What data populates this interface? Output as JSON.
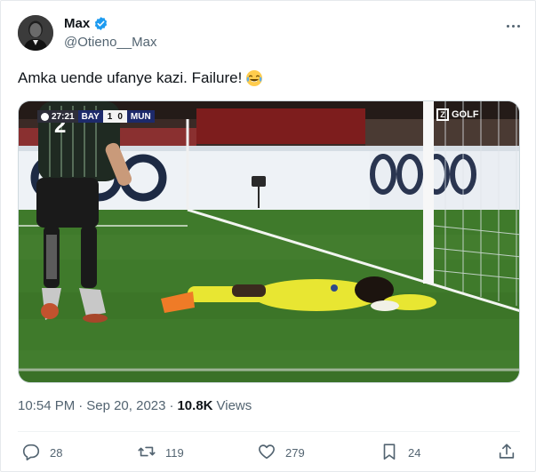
{
  "author": {
    "name": "Max",
    "handle": "@Otieno__Max",
    "verified": true
  },
  "tweet": {
    "text": "Amka uende ufanye kazi. Failure!",
    "emoji": "face-with-tears-of-joy"
  },
  "media": {
    "scorebug": {
      "clock": "27:21",
      "home_team": "BAY",
      "home_score": "1",
      "away_score": "0",
      "away_team": "MUN"
    },
    "broadcaster": "GOLF",
    "broadcaster_logo_letter": "Z",
    "colors": {
      "pitch": "#3f7a2b",
      "keeper_kit": "#e8e632",
      "player_kit": "#1f2a22"
    }
  },
  "meta": {
    "time": "10:54 PM",
    "separator": "·",
    "date": "Sep 20, 2023",
    "views_count": "10.8K",
    "views_label": "Views"
  },
  "actions": {
    "replies": "28",
    "reposts": "119",
    "likes": "279",
    "bookmarks": "24"
  },
  "icons": {
    "verified": "verified-badge-icon",
    "more": "more-options-icon",
    "reply": "reply-icon",
    "repost": "repost-icon",
    "like": "like-icon",
    "bookmark": "bookmark-icon",
    "share": "share-icon"
  },
  "colors": {
    "accent": "#1d9bf0",
    "secondary_text": "#536471",
    "primary_text": "#0f1419"
  }
}
